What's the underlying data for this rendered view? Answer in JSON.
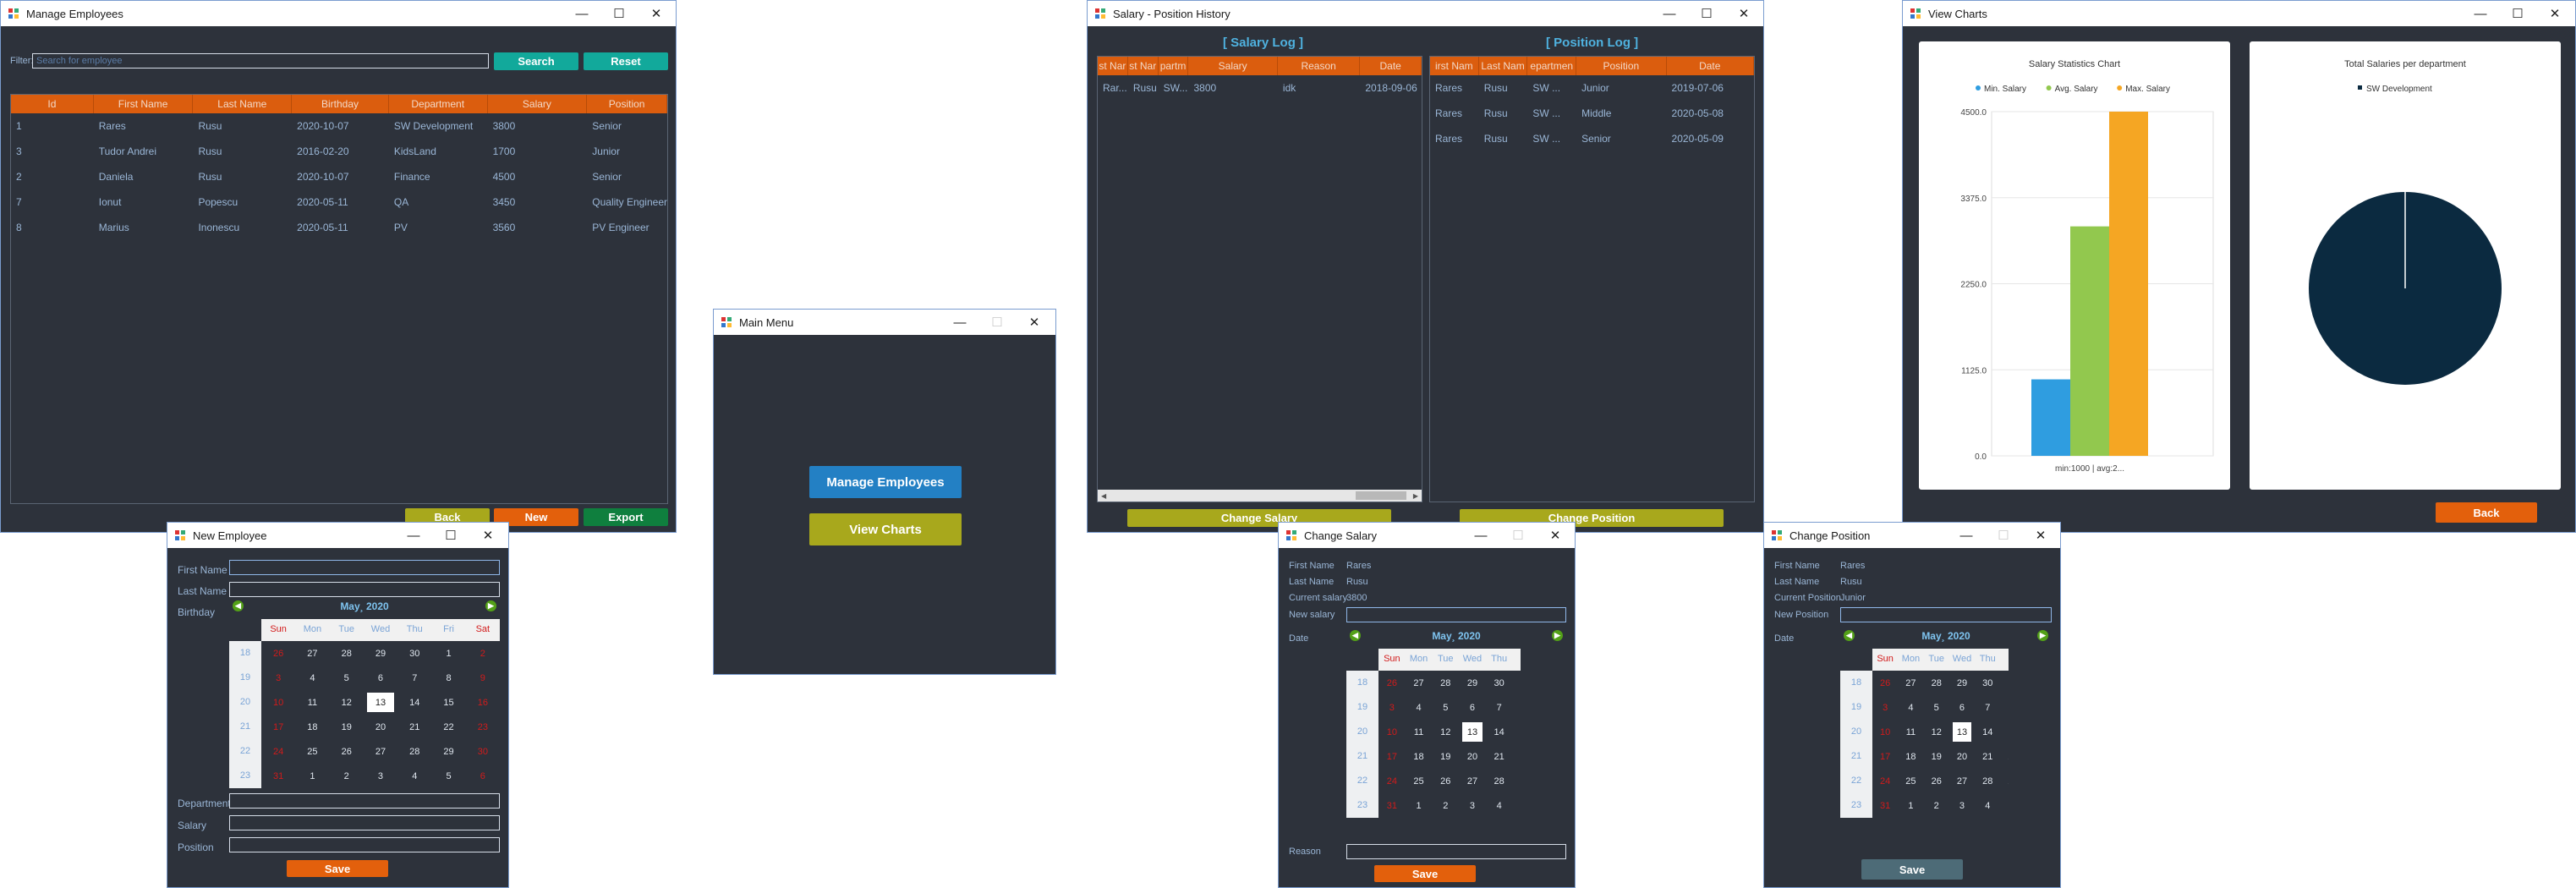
{
  "manage": {
    "title": "Manage Employees",
    "filter_label": "Filter:",
    "filter_placeholder": "Search for employee",
    "search": "Search",
    "reset": "Reset",
    "columns": [
      "Id",
      "First Name",
      "Last Name",
      "Birthday",
      "Department",
      "Salary",
      "Position"
    ],
    "rows": [
      [
        "1",
        "Rares",
        "Rusu",
        "2020-10-07",
        "SW Development",
        "3800",
        "Senior"
      ],
      [
        "3",
        "Tudor Andrei",
        "Rusu",
        "2016-02-20",
        "KidsLand",
        "1700",
        "Junior"
      ],
      [
        "2",
        "Daniela",
        "Rusu",
        "2020-10-07",
        "Finance",
        "4500",
        "Senior"
      ],
      [
        "7",
        "Ionut",
        "Popescu",
        "2020-05-11",
        "QA",
        "3450",
        "Quality Engineer"
      ],
      [
        "8",
        "Marius",
        "Inonescu",
        "2020-05-11",
        "PV",
        "3560",
        "PV Engineer"
      ]
    ],
    "back": "Back",
    "new": "New",
    "export": "Export"
  },
  "menu": {
    "title": "Main Menu",
    "manage": "Manage Employees",
    "charts": "View Charts"
  },
  "history": {
    "title": "Salary - Position History",
    "salary_title": "[ Salary Log ]",
    "position_title": "[ Position Log ]",
    "salary_columns": [
      "st Nar",
      "st Nar",
      "partm",
      "Salary",
      "Reason",
      "Date"
    ],
    "salary_rows": [
      [
        "Rar...",
        "Rusu",
        "SW...",
        "3800",
        "idk",
        "2018-09-06"
      ]
    ],
    "position_columns": [
      "irst Nam",
      "Last Nam",
      "epartmen",
      "Position",
      "Date"
    ],
    "position_rows": [
      [
        "Rares",
        "Rusu",
        "SW ...",
        "Junior",
        "2019-07-06"
      ],
      [
        "Rares",
        "Rusu",
        "SW ...",
        "Middle",
        "2020-05-08"
      ],
      [
        "Rares",
        "Rusu",
        "SW ...",
        "Senior",
        "2020-05-09"
      ]
    ],
    "change_salary": "Change Salary",
    "change_position": "Change Position"
  },
  "charts": {
    "title": "View Charts",
    "back": "Back",
    "bar_title": "Salary Statistics Chart",
    "pie_title": "Total Salaries per department",
    "bar_x_label": "min:1000 | avg:2...",
    "pie_legend": "SW Development"
  },
  "chart_data": [
    {
      "type": "bar",
      "title": "Salary Statistics Chart",
      "categories": [
        "min:1000 | avg:2..."
      ],
      "series": [
        {
          "name": "Min. Salary",
          "values": [
            1000
          ],
          "color": "#2f9de0"
        },
        {
          "name": "Avg. Salary",
          "values": [
            3000
          ],
          "color": "#92c84e"
        },
        {
          "name": "Max. Salary",
          "values": [
            4500
          ],
          "color": "#f5a623"
        }
      ],
      "yticks": [
        "0.0",
        "1125.0",
        "2250.0",
        "3375.0",
        "4500.0"
      ],
      "ylim": [
        0,
        4500
      ]
    },
    {
      "type": "pie",
      "title": "Total Salaries per department",
      "slices": [
        {
          "label": "SW Development",
          "value": 100,
          "color": "#0b2a40"
        }
      ]
    }
  ],
  "new_employee": {
    "title": "New Employee",
    "first_name": "First Name",
    "last_name": "Last Name",
    "birthday": "Birthday",
    "department": "Department",
    "salary": "Salary",
    "position": "Position",
    "save": "Save"
  },
  "calendar": {
    "month_year": "May¸   2020",
    "dows_full": [
      "Sun",
      "Mon",
      "Tue",
      "Wed",
      "Thu",
      "Fri",
      "Sat"
    ],
    "weeks": [
      "18",
      "19",
      "20",
      "21",
      "22",
      "23"
    ],
    "days": [
      [
        "26",
        "27",
        "28",
        "29",
        "30",
        "1",
        "2"
      ],
      [
        "3",
        "4",
        "5",
        "6",
        "7",
        "8",
        "9"
      ],
      [
        "10",
        "11",
        "12",
        "13",
        "14",
        "15",
        "16"
      ],
      [
        "17",
        "18",
        "19",
        "20",
        "21",
        "22",
        "23"
      ],
      [
        "24",
        "25",
        "26",
        "27",
        "28",
        "29",
        "30"
      ],
      [
        "31",
        "1",
        "2",
        "3",
        "4",
        "5",
        "6"
      ]
    ],
    "selected": "13"
  },
  "change_salary": {
    "title": "Change Salary",
    "first_name_label": "First Name",
    "last_name_label": "Last Name",
    "current_salary_label": "Current salary",
    "new_salary_label": "New salary",
    "date_label": "Date",
    "reason_label": "Reason",
    "first_name": "Rares",
    "last_name": "Rusu",
    "current_salary": "3800",
    "save": "Save"
  },
  "change_position": {
    "title": "Change Position",
    "first_name_label": "First Name",
    "last_name_label": "Last Name",
    "current_position_label": "Current Position",
    "new_position_label": "New Position",
    "date_label": "Date",
    "first_name": "Rares",
    "last_name": "Rusu",
    "current_position": "Junior",
    "save": "Save"
  }
}
